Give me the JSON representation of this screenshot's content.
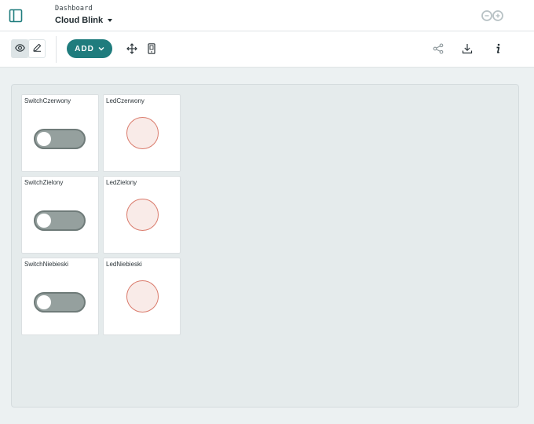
{
  "header": {
    "breadcrumb": "Dashboard",
    "title": "Cloud Blink",
    "logo": "arduino-logo"
  },
  "toolbar": {
    "view_icon": "eye-icon",
    "edit_icon": "pencil-icon",
    "add_label": "ADD",
    "move_icon": "move-icon",
    "mobile_icon": "mobile-icon",
    "share_icon": "share-icon",
    "download_icon": "download-icon",
    "info_icon": "info-icon"
  },
  "widgets": [
    {
      "type": "switch",
      "name": "SwitchCzerwony",
      "state": "off"
    },
    {
      "type": "led",
      "name": "LedCzerwony",
      "state": "off"
    },
    {
      "type": "switch",
      "name": "SwitchZielony",
      "state": "off"
    },
    {
      "type": "led",
      "name": "LedZielony",
      "state": "off"
    },
    {
      "type": "switch",
      "name": "SwitchNiebieski",
      "state": "off"
    },
    {
      "type": "led",
      "name": "LedNiebieski",
      "state": "off"
    }
  ],
  "colors": {
    "accent": "#1f7c7d",
    "switch_off": "#95a09e",
    "led_off_fill": "#f9ebe8",
    "led_off_border": "#da7b6c"
  }
}
